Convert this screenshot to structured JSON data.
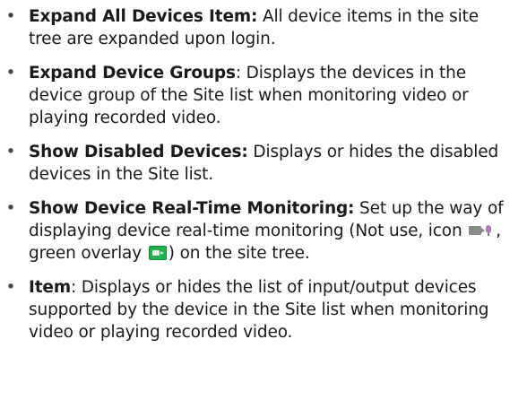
{
  "items": [
    {
      "term": "Expand All Devices Item:",
      "desc": " All device items in the site tree are expanded upon login."
    },
    {
      "term": "Expand Device Groups",
      "desc": ": Displays the devices in the device group of the Site list when monitoring video or playing recorded video."
    },
    {
      "term": "Show Disabled Devices:",
      "desc": " Displays or hides the disabled devices in the Site list."
    },
    {
      "term": "Show Device Real-Time Monitoring:",
      "desc_a": " Set up the way of displaying device real-time monitoring (Not use, icon ",
      "desc_b": ", green overlay ",
      "desc_c": ") on the site tree."
    },
    {
      "term": "Item",
      "desc": ": Displays or hides the list of input/output devices supported by the device in the Site list when monitoring video or playing recorded video."
    }
  ],
  "bullet": "•",
  "icons": {
    "device_status_icon": "camera-mic-icon",
    "overlay_icon": "green-overlay-icon",
    "overlay_color": "#22b14c"
  }
}
